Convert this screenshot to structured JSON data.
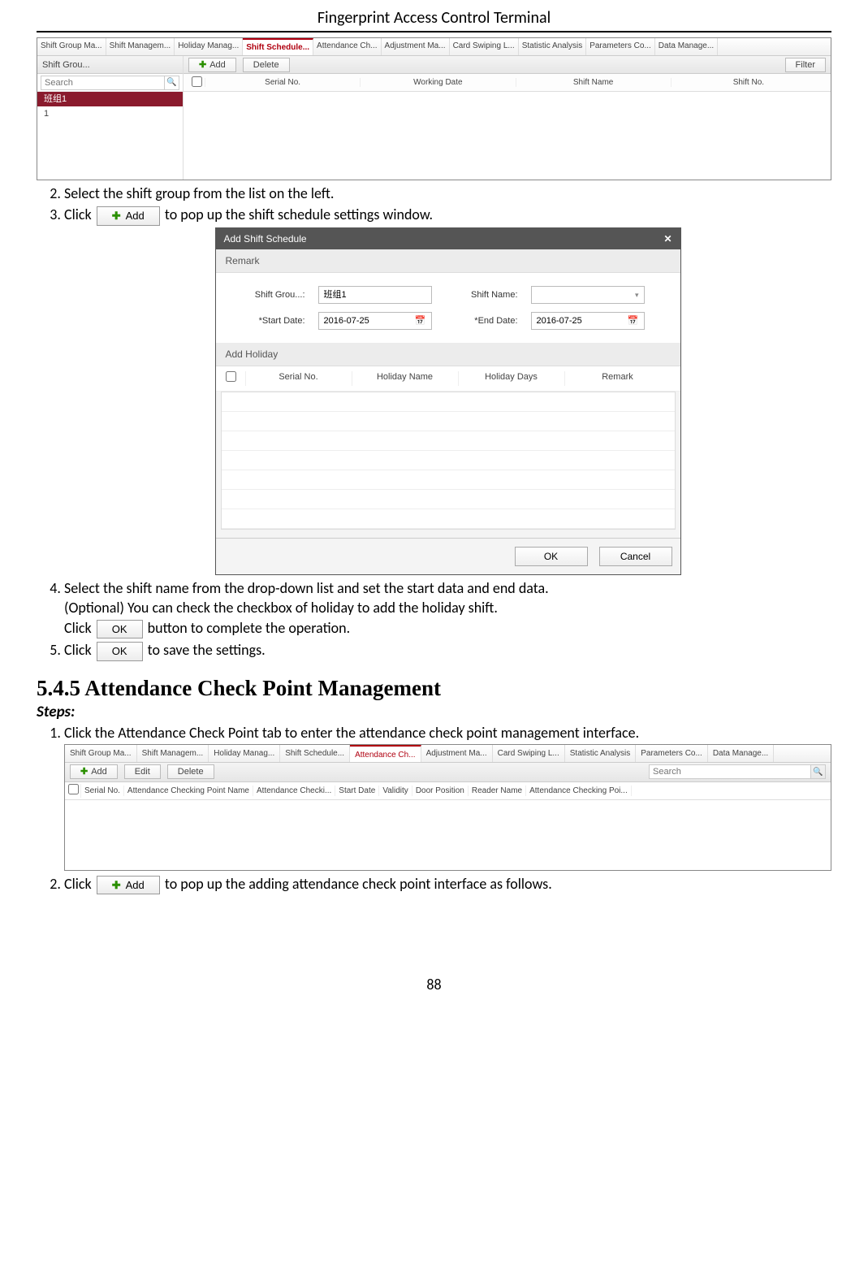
{
  "doc_title": "Fingerprint Access Control Terminal",
  "page_number": "88",
  "shot1": {
    "tabs": [
      "Shift Group Ma...",
      "Shift Managem...",
      "Holiday Manag...",
      "Shift Schedule...",
      "Attendance Ch...",
      "Adjustment Ma...",
      "Card Swiping L...",
      "Statistic Analysis",
      "Parameters Co...",
      "Data Manage..."
    ],
    "active_tab": 3,
    "left_header": "Shift Grou...",
    "search_placeholder": "Search",
    "items": [
      "班组1",
      "1"
    ],
    "selected_item": 0,
    "toolbar": {
      "add": "Add",
      "delete": "Delete",
      "filter": "Filter"
    },
    "columns": [
      "Serial No.",
      "Working Date",
      "Shift Name",
      "Shift No."
    ]
  },
  "step2": "Select the shift group from the list on the left.",
  "step3_pre": "Click",
  "step3_btn": "Add",
  "step3_post": "to pop up the shift schedule settings window.",
  "dialog": {
    "title": "Add Shift Schedule",
    "remark": "Remark",
    "fields": {
      "shift_group_label": "Shift Grou...:",
      "shift_group_value": "班组1",
      "shift_name_label": "Shift Name:",
      "shift_name_value": "",
      "start_date_label": "*Start Date:",
      "start_date_value": "2016-07-25",
      "end_date_label": "*End Date:",
      "end_date_value": "2016-07-25"
    },
    "add_holiday": "Add Holiday",
    "hcols": [
      "Serial No.",
      "Holiday Name",
      "Holiday Days",
      "Remark"
    ],
    "ok": "OK",
    "cancel": "Cancel"
  },
  "step4_line1": "Select the shift name from the drop-down list and set the start data and end data.",
  "step4_line2": "(Optional) You can check the checkbox of holiday to add the holiday shift.",
  "step4_line3_pre": "Click",
  "step4_line3_post": "button to complete the operation.",
  "ok_btn": "OK",
  "step5_pre": "Click",
  "step5_post": "to save the settings.",
  "section_heading": "5.4.5   Attendance Check Point Management",
  "steps_label": "Steps:",
  "acp_step1": "Click the Attendance Check Point tab to enter the attendance check point management interface.",
  "shot3": {
    "tabs": [
      "Shift Group Ma...",
      "Shift Managem...",
      "Holiday Manag...",
      "Shift Schedule...",
      "Attendance Ch...",
      "Adjustment Ma...",
      "Card Swiping L...",
      "Statistic Analysis",
      "Parameters Co...",
      "Data Manage..."
    ],
    "active_tab": 4,
    "toolbar": {
      "add": "Add",
      "edit": "Edit",
      "delete": "Delete",
      "search": "Search"
    },
    "columns": [
      "Serial No.",
      "Attendance Checking Point Name",
      "Attendance Checki...",
      "Start Date",
      "Validity",
      "Door Position",
      "Reader Name",
      "Attendance Checking Poi..."
    ]
  },
  "acp_step2_pre": "Click",
  "acp_step2_btn": "Add",
  "acp_step2_post": "to pop up the adding attendance check point interface as follows."
}
